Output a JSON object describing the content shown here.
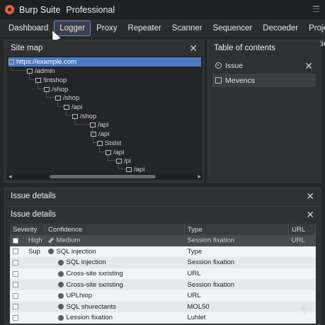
{
  "app": {
    "name": "Burp Suite",
    "edition": "Professional"
  },
  "tabs": [
    "Dashboard",
    "Logger",
    "Proxy",
    "Repeater",
    "Scanner",
    "Sequencer",
    "Decoeder",
    "Project Options"
  ],
  "active_tab": "Logger",
  "sitemap": {
    "title": "Site map",
    "close": "✕",
    "nodes": [
      {
        "label": "https://example.com",
        "icon": "page-icon",
        "selected": true
      },
      {
        "label": "/admin",
        "icon": "folder-icon"
      },
      {
        "label": "!intshop",
        "icon": "gear-icon"
      },
      {
        "label": "/shop",
        "icon": "folder-icon"
      },
      {
        "label": "/shop",
        "icon": "page-icon"
      },
      {
        "label": "/api",
        "icon": "globe-icon"
      },
      {
        "label": "/shop",
        "icon": "image-icon"
      },
      {
        "label": "/api",
        "icon": "folder-icon"
      },
      {
        "label": "/api",
        "icon": "image-icon"
      },
      {
        "label": "Stslst",
        "icon": "bug-icon"
      },
      {
        "label": "/api",
        "icon": "monitor-icon"
      },
      {
        "label": "/pi",
        "icon": "image-icon"
      },
      {
        "label": "/api",
        "icon": "image-icon"
      }
    ]
  },
  "toc": {
    "title": "Table of contents",
    "section_label": "Issue",
    "close": "✕",
    "items": [
      "Mevencs"
    ]
  },
  "issues_outer": {
    "title": "Issue details",
    "close": "✕"
  },
  "issues": {
    "title": "Issue details",
    "close": "✕",
    "columns": [
      "Severity",
      "Confidence",
      "Type",
      "URL"
    ],
    "rows": [
      {
        "severity": "High",
        "confidence": "Medium",
        "type": "Session fixation",
        "url": "URL",
        "highlight": true
      },
      {
        "severity": "Sup",
        "confidence": "SQL injection",
        "type": "Type",
        "url": ""
      },
      {
        "severity": "",
        "confidence": "SQL injection",
        "type": "Session fixation",
        "url": ""
      },
      {
        "severity": "",
        "confidence": "Cross-site sxristing",
        "type": "URL",
        "url": ""
      },
      {
        "severity": "",
        "confidence": "Cross-site sxristing",
        "type": "Session fixation",
        "url": ""
      },
      {
        "severity": "",
        "confidence": "UPLhiop",
        "type": "URL",
        "url": ""
      },
      {
        "severity": "",
        "confidence": "SQL shurectants",
        "type": "MOL50",
        "url": ""
      },
      {
        "severity": "",
        "confidence": "Lession fixation",
        "type": "Luhlet",
        "url": ""
      }
    ]
  }
}
